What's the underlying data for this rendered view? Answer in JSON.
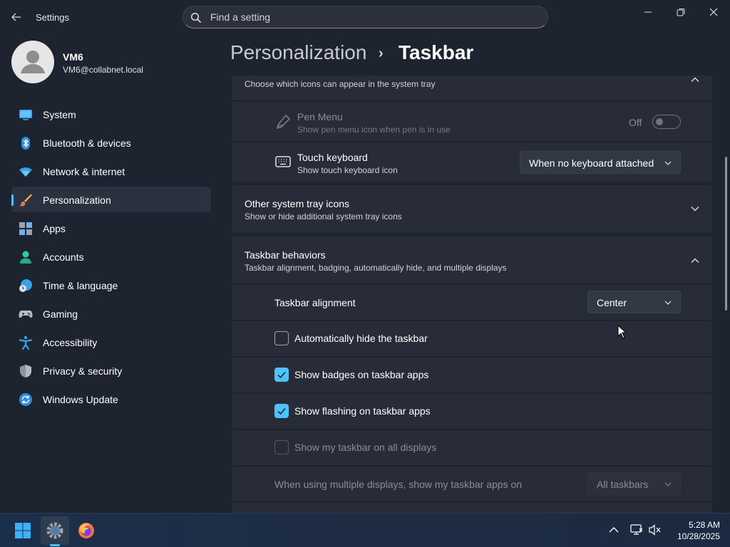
{
  "app": {
    "title": "Settings"
  },
  "search": {
    "placeholder": "Find a setting"
  },
  "user": {
    "name": "VM6",
    "email": "VM6@collabnet.local"
  },
  "nav": [
    {
      "label": "System",
      "icon": "monitor-icon"
    },
    {
      "label": "Bluetooth & devices",
      "icon": "bluetooth-icon"
    },
    {
      "label": "Network & internet",
      "icon": "wifi-icon"
    },
    {
      "label": "Personalization",
      "icon": "paintbrush-icon",
      "active": true
    },
    {
      "label": "Apps",
      "icon": "apps-icon"
    },
    {
      "label": "Accounts",
      "icon": "person-icon"
    },
    {
      "label": "Time & language",
      "icon": "clock-globe-icon"
    },
    {
      "label": "Gaming",
      "icon": "gamepad-icon"
    },
    {
      "label": "Accessibility",
      "icon": "accessibility-icon"
    },
    {
      "label": "Privacy & security",
      "icon": "shield-icon"
    },
    {
      "label": "Windows Update",
      "icon": "update-icon"
    }
  ],
  "header": {
    "parent": "Personalization",
    "separator": "›",
    "current": "Taskbar"
  },
  "system_tray": {
    "subtitle": "Choose which icons can appear in the system tray"
  },
  "pen_menu": {
    "title": "Pen Menu",
    "subtitle": "Show pen menu icon when pen is in use",
    "state_label": "Off"
  },
  "touch_keyboard": {
    "title": "Touch keyboard",
    "subtitle": "Show touch keyboard icon",
    "value": "When no keyboard attached"
  },
  "other_tray": {
    "title": "Other system tray icons",
    "subtitle": "Show or hide additional system tray icons"
  },
  "behaviors": {
    "title": "Taskbar behaviors",
    "subtitle": "Taskbar alignment, badging, automatically hide, and multiple displays",
    "alignment_label": "Taskbar alignment",
    "alignment_value": "Center",
    "options": [
      {
        "label": "Automatically hide the taskbar",
        "checked": false,
        "disabled": false
      },
      {
        "label": "Show badges on taskbar apps",
        "checked": true,
        "disabled": false
      },
      {
        "label": "Show flashing on taskbar apps",
        "checked": true,
        "disabled": false
      },
      {
        "label": "Show my taskbar on all displays",
        "checked": false,
        "disabled": true
      }
    ],
    "multi_display_label": "When using multiple displays, show my taskbar apps on",
    "multi_display_value": "All taskbars"
  },
  "taskbar": {
    "time": "5:28 AM",
    "date": "10/28/2025"
  },
  "colors": {
    "accent": "#4cc2ff",
    "background": "#1e2330",
    "card": "#272c38"
  }
}
